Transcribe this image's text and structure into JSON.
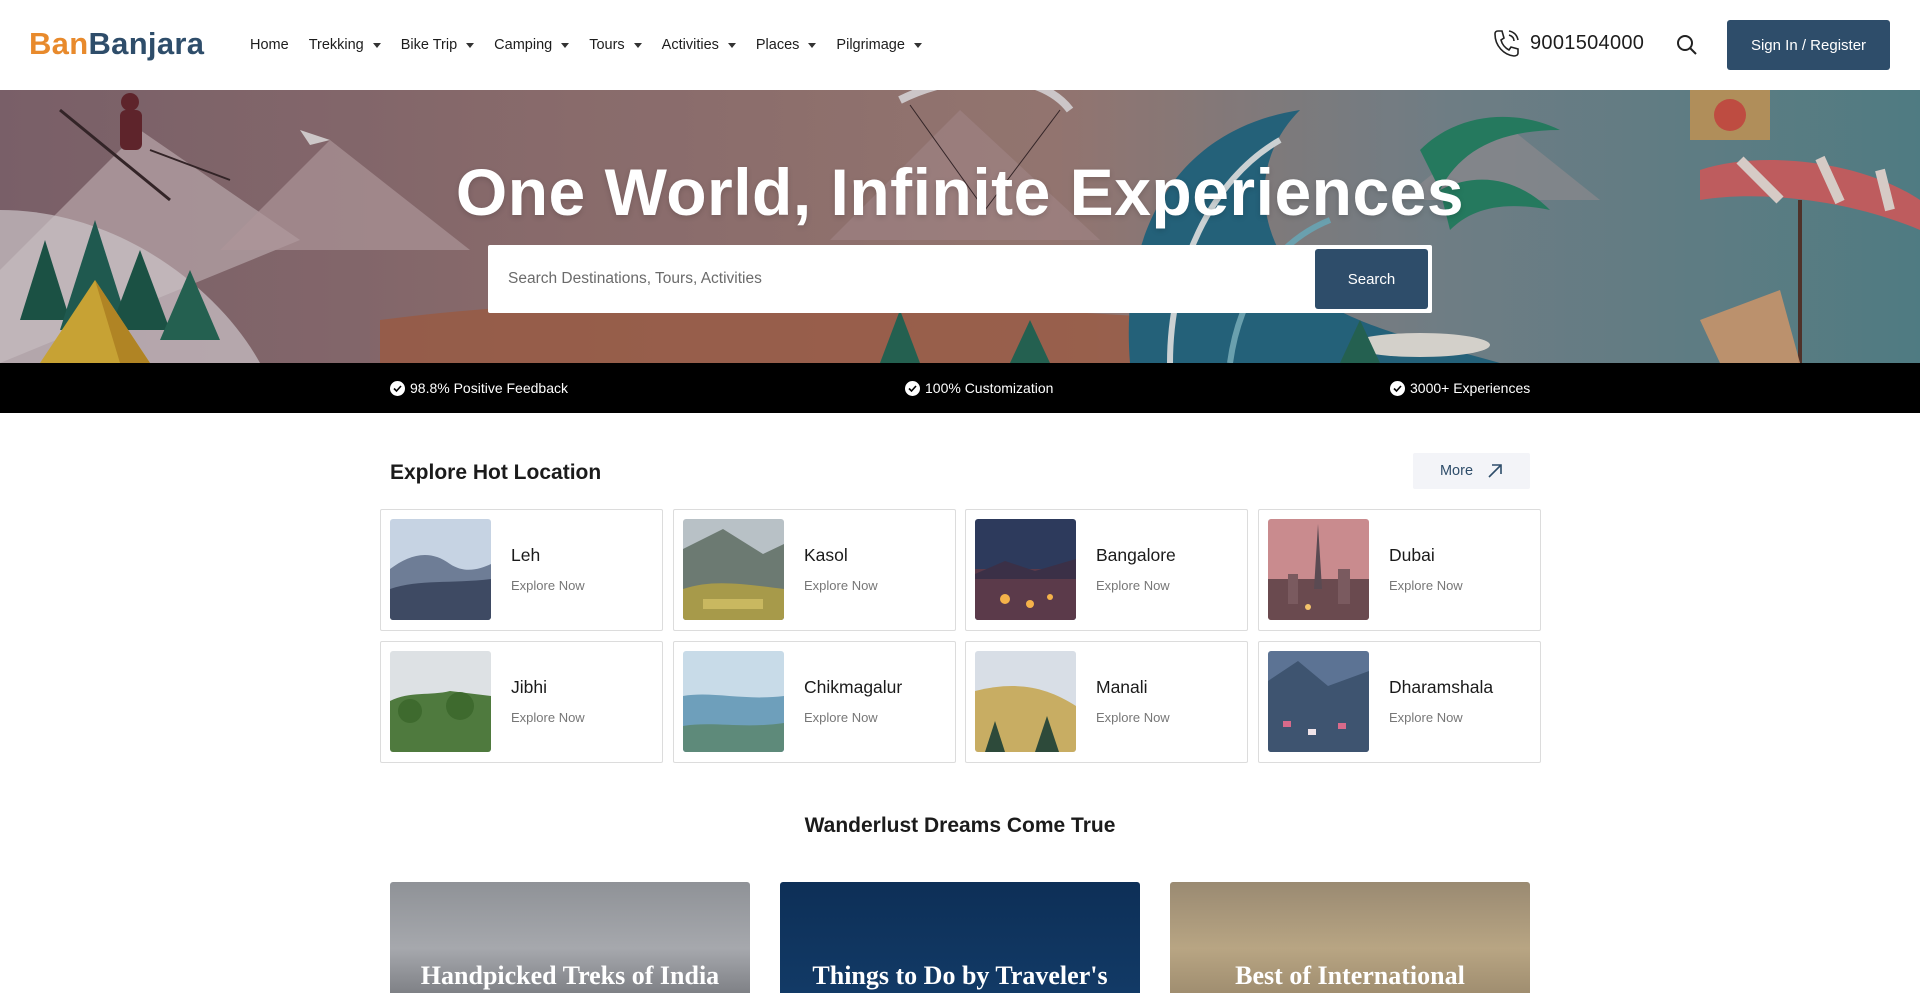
{
  "header": {
    "logo_part1": "Ban",
    "logo_part2": "Banjara",
    "nav": [
      {
        "label": "Home",
        "dropdown": false
      },
      {
        "label": "Trekking",
        "dropdown": true
      },
      {
        "label": "Bike Trip",
        "dropdown": true
      },
      {
        "label": "Camping",
        "dropdown": true
      },
      {
        "label": "Tours",
        "dropdown": true
      },
      {
        "label": "Activities",
        "dropdown": true
      },
      {
        "label": "Places",
        "dropdown": true
      },
      {
        "label": "Pilgrimage",
        "dropdown": true
      }
    ],
    "phone": "9001504000",
    "signin_label": "Sign In / Register"
  },
  "hero": {
    "title": "One World, Infinite Experiences",
    "search_placeholder": "Search Destinations, Tours, Activities",
    "search_button": "Search"
  },
  "features": [
    "98.8% Positive Feedback",
    "100% Customization",
    "3000+ Experiences"
  ],
  "explore": {
    "title": "Explore Hot Location",
    "more_label": "More",
    "locations": [
      {
        "name": "Leh",
        "cta": "Explore Now"
      },
      {
        "name": "Kasol",
        "cta": "Explore Now"
      },
      {
        "name": "Bangalore",
        "cta": "Explore Now"
      },
      {
        "name": "Dubai",
        "cta": "Explore Now"
      },
      {
        "name": "Jibhi",
        "cta": "Explore Now"
      },
      {
        "name": "Chikmagalur",
        "cta": "Explore Now"
      },
      {
        "name": "Manali",
        "cta": "Explore Now"
      },
      {
        "name": "Dharamshala",
        "cta": "Explore Now"
      }
    ]
  },
  "dreams": {
    "title": "Wanderlust Dreams Come True",
    "cards": [
      {
        "title": "Handpicked Treks of India"
      },
      {
        "title": "Things to Do by Traveler's Choice"
      },
      {
        "title": "Best of International"
      }
    ]
  },
  "colors": {
    "brand_dark": "#2e4d6a",
    "brand_orange": "#e88a2c",
    "feature_bar": "#000000"
  }
}
